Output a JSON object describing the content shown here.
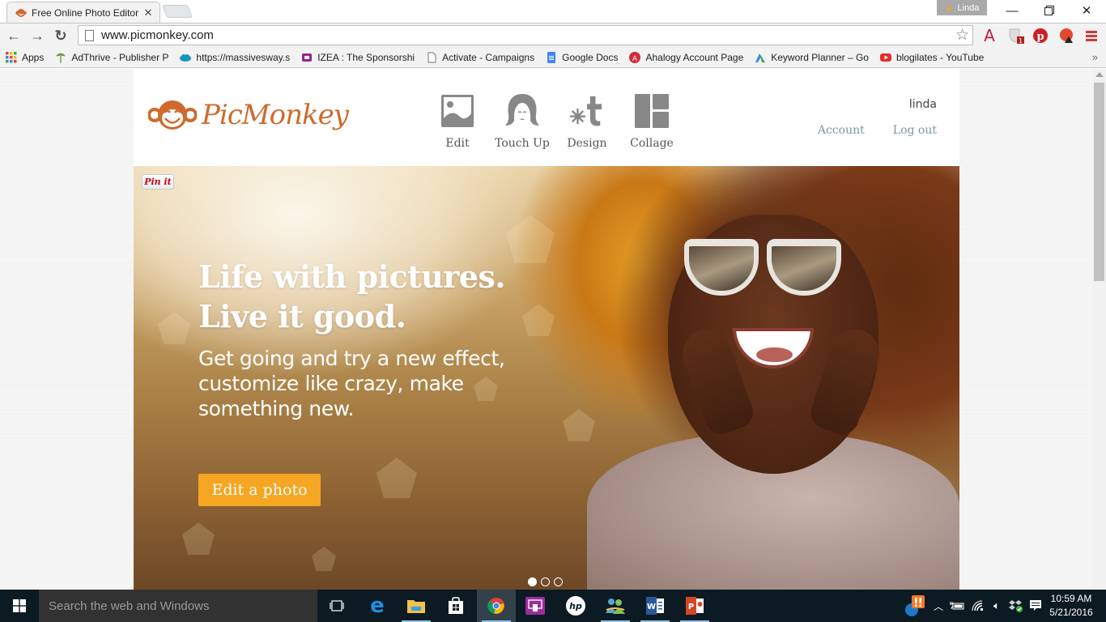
{
  "browser": {
    "tab_title": "Free Online Photo Editor | ",
    "tab_close": "✕",
    "profile_name": "Linda",
    "url": "www.picmonkey.com",
    "extension_badge": "1",
    "bookmarks": [
      {
        "label": "Apps",
        "icon": "apps-grid-icon"
      },
      {
        "label": "AdThrive - Publisher P",
        "icon": "adthrive-icon"
      },
      {
        "label": "https://massivesway.s",
        "icon": "salesforce-cloud-icon"
      },
      {
        "label": "IZEA : The Sponsorshi",
        "icon": "izea-icon"
      },
      {
        "label": "Activate - Campaigns",
        "icon": "page-icon"
      },
      {
        "label": "Google Docs",
        "icon": "google-docs-icon"
      },
      {
        "label": "Ahalogy Account Page",
        "icon": "ahalogy-icon"
      },
      {
        "label": "Keyword Planner – Go",
        "icon": "adwords-icon"
      },
      {
        "label": "blogilates - YouTube",
        "icon": "youtube-icon"
      }
    ],
    "bookmarks_more": "»"
  },
  "site": {
    "brand": "PicMonkey",
    "brand_color": "#cf6a2d",
    "tools": [
      {
        "label": "Edit",
        "icon": "image-edit-icon"
      },
      {
        "label": "Touch Up",
        "icon": "face-touchup-icon"
      },
      {
        "label": "Design",
        "icon": "design-snowflake-t-icon"
      },
      {
        "label": "Collage",
        "icon": "collage-grid-icon"
      }
    ],
    "username": "linda",
    "account_label": "Account",
    "logout_label": "Log out",
    "pinit_label": "Pin it",
    "hero": {
      "headline_line1": "Life with pictures.",
      "headline_line2": "Live it good.",
      "subline": "Get going and try a new effect, customize like crazy, make something new.",
      "cta_label": "Edit a photo",
      "cta_color": "#f5a623",
      "slides_total": 3,
      "slide_active": 1
    }
  },
  "taskbar": {
    "search_placeholder": "Search the web and Windows",
    "apps": [
      "task-view",
      "edge",
      "file-explorer",
      "store",
      "chrome",
      "presenter",
      "hp",
      "messenger",
      "word",
      "powerpoint"
    ],
    "time": "10:59 AM",
    "date": "5/21/2016"
  }
}
